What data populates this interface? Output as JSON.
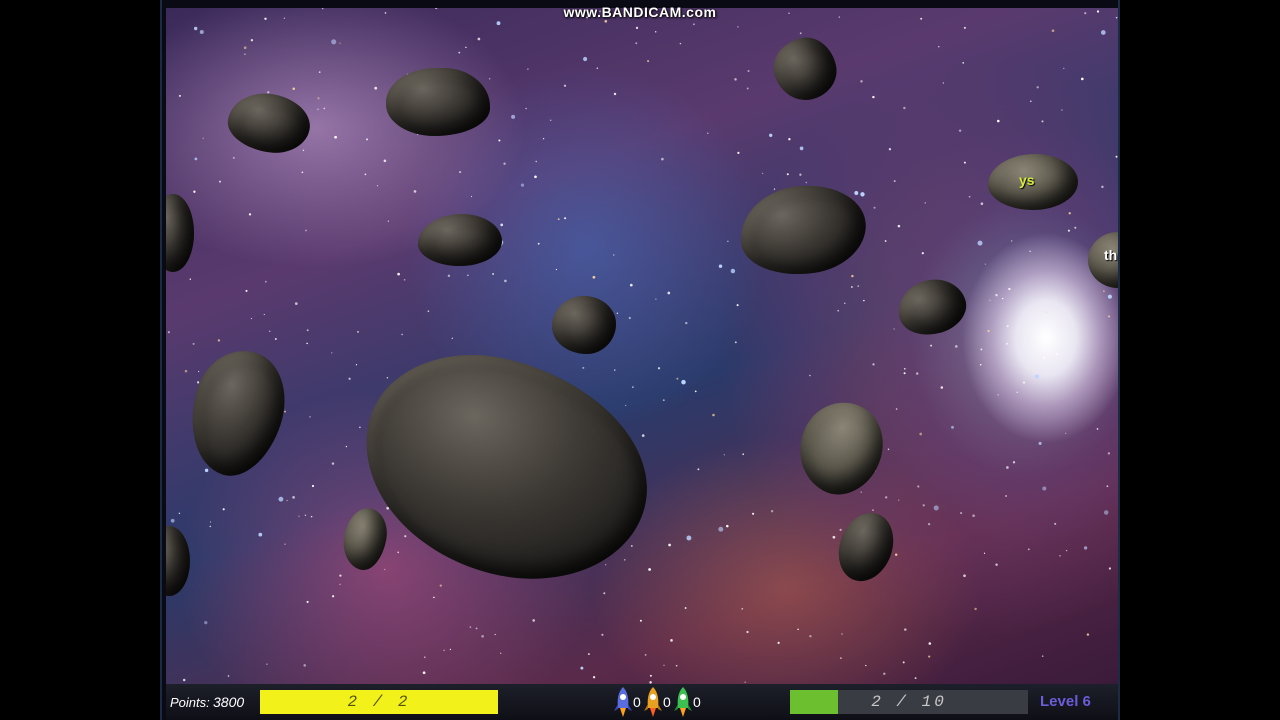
{
  "watermark": "www.BANDICAM.com",
  "scene": {
    "asteroid_words": [
      {
        "text": "ys",
        "color": "#d4ec3a"
      },
      {
        "text": "thi",
        "color": "#ffffff"
      }
    ]
  },
  "hud": {
    "points_label": "Points:",
    "points_value": "3800",
    "word_progress": {
      "text": "2 / 2",
      "fraction": 1.0,
      "color": "#f2f21a"
    },
    "lives": [
      {
        "color": "blue",
        "count": "0"
      },
      {
        "color": "orange",
        "count": "0"
      },
      {
        "color": "green",
        "count": "0"
      }
    ],
    "level_progress": {
      "text": "2 / 10",
      "fraction": 0.2,
      "color": "#6cc030"
    },
    "level_label": "Level 6"
  }
}
